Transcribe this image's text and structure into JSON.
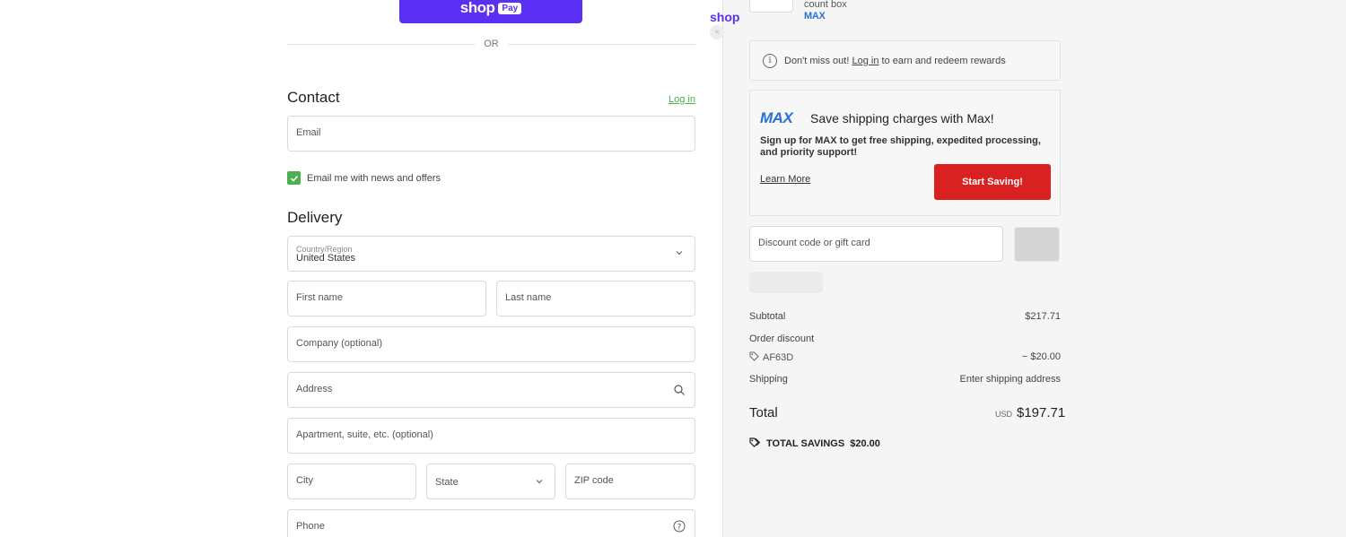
{
  "express": {
    "shop_pay_word": "shop",
    "shop_pay_badge": "Pay",
    "or_text": "OR"
  },
  "contact": {
    "heading": "Contact",
    "login_link": "Log in",
    "email_placeholder": "Email",
    "news_checkbox_label": "Email me with news and offers",
    "news_checked": true
  },
  "delivery": {
    "heading": "Delivery",
    "country_label": "Country/Region",
    "country_value": "United States",
    "first_name_placeholder": "First name",
    "last_name_placeholder": "Last name",
    "company_placeholder": "Company (optional)",
    "address_placeholder": "Address",
    "apartment_placeholder": "Apartment, suite, etc. (optional)",
    "city_placeholder": "City",
    "state_placeholder": "State",
    "zip_placeholder": "ZIP code",
    "phone_placeholder": "Phone"
  },
  "order": {
    "item_title": "count box",
    "item_brand_logo": "MAX",
    "shop_logo": "shop"
  },
  "rewards": {
    "prefix": "Don't miss out!",
    "link": "Log in",
    "suffix": "to earn and redeem rewards"
  },
  "max_promo": {
    "logo": "MAX",
    "title": "Save shipping charges with Max!",
    "description": "Sign up for MAX to get free shipping, expedited processing, and priority support!",
    "learn_more": "Learn More",
    "cta": "Start Saving!",
    "accent_color": "#d92121",
    "brand_color": "#2b6fd6"
  },
  "discount": {
    "placeholder": "Discount code or gift card"
  },
  "summary": {
    "subtotal_label": "Subtotal",
    "subtotal_value": "$217.71",
    "order_discount_label": "Order discount",
    "discount_code": "AF63D",
    "discount_value": "− $20.00",
    "shipping_label": "Shipping",
    "shipping_value": "Enter shipping address",
    "total_label": "Total",
    "total_currency": "USD",
    "total_value": "$197.71",
    "savings_label": "TOTAL SAVINGS",
    "savings_value": "$20.00"
  },
  "colors": {
    "shop_pay": "#5a31f4",
    "login_link": "#4caf50",
    "checkbox": "#4caf50"
  }
}
